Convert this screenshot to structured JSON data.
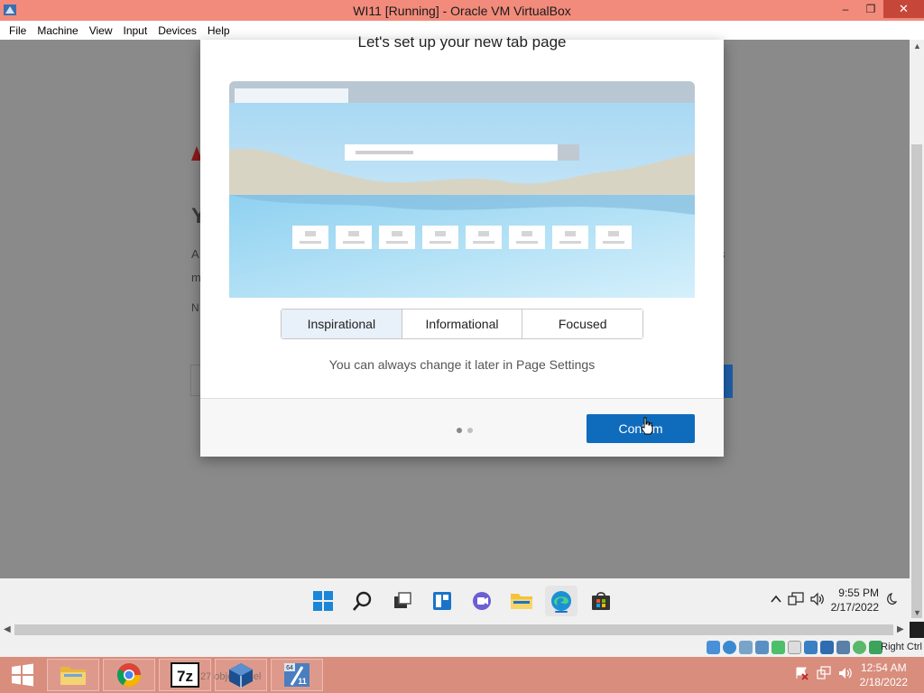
{
  "window": {
    "title": "WI11 [Running] - Oracle VM VirtualBox",
    "controls": {
      "minimize": "–",
      "restore": "❐",
      "close": "✕"
    }
  },
  "menu": [
    "File",
    "Machine",
    "View",
    "Input",
    "Devices",
    "Help"
  ],
  "background_page": {
    "heading_letter": "Y",
    "line_1": "A",
    "line_2": "m",
    "line_3": "N",
    "right_fragment": "s"
  },
  "dialog": {
    "title": "Let's set up your new tab page",
    "layout_options": [
      "Inspirational",
      "Informational",
      "Focused"
    ],
    "selected_option": "Inspirational",
    "hint": "You can always change it later in Page Settings",
    "pagination": {
      "current": 1,
      "total": 2
    },
    "confirm_label": "Confirm"
  },
  "guest_taskbar": {
    "apps": [
      "start-icon",
      "search-icon",
      "task-view-icon",
      "widgets-icon",
      "chat-icon",
      "file-explorer-icon",
      "edge-icon",
      "store-icon"
    ],
    "active_app": "edge-icon",
    "time": "9:55 PM",
    "date": "2/17/2022"
  },
  "vbox_status": {
    "host_key_label": "Right Ctrl"
  },
  "host_taskbar": {
    "apps": [
      "file-explorer",
      "chrome",
      "7-zip",
      "virtualbox",
      "wi11-vm"
    ],
    "ghost_text": "27 objects sel",
    "time": "12:54 AM",
    "date": "2/18/2022"
  },
  "colors": {
    "title_bar": "#f28b7c",
    "host_taskbar": "#d98d7d",
    "accent": "#0f6cbd",
    "overlay": "#8a8a8a"
  }
}
